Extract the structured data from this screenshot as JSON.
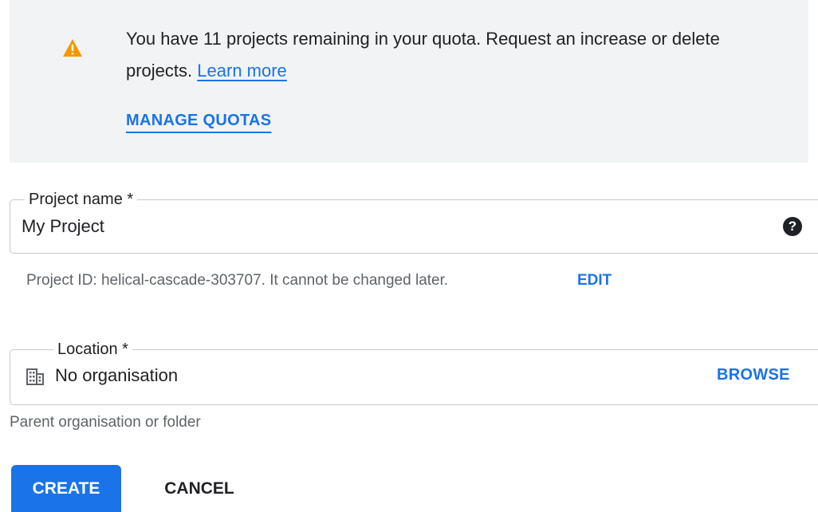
{
  "quota_banner": {
    "message": "You have 11 projects remaining in your quota. Request an increase or delete projects.",
    "learn_more_label": "Learn more",
    "manage_quotas_label": "MANAGE QUOTAS",
    "icon": "warning-icon",
    "icon_color": "#f29900"
  },
  "project_name": {
    "label": "Project name *",
    "value": "My Project",
    "help_icon": "help-icon"
  },
  "project_id": {
    "text": "Project ID: helical-cascade-303707. It cannot be changed later.",
    "edit_label": "EDIT"
  },
  "location": {
    "label": "Location *",
    "value": "No organisation",
    "icon": "building-icon",
    "browse_label": "BROWSE",
    "helper_text": "Parent organisation or folder"
  },
  "actions": {
    "create_label": "CREATE",
    "cancel_label": "CANCEL"
  },
  "colors": {
    "accent": "#1a73e8",
    "banner_background": "#f1f3f4",
    "secondary_text": "#5f6368"
  }
}
